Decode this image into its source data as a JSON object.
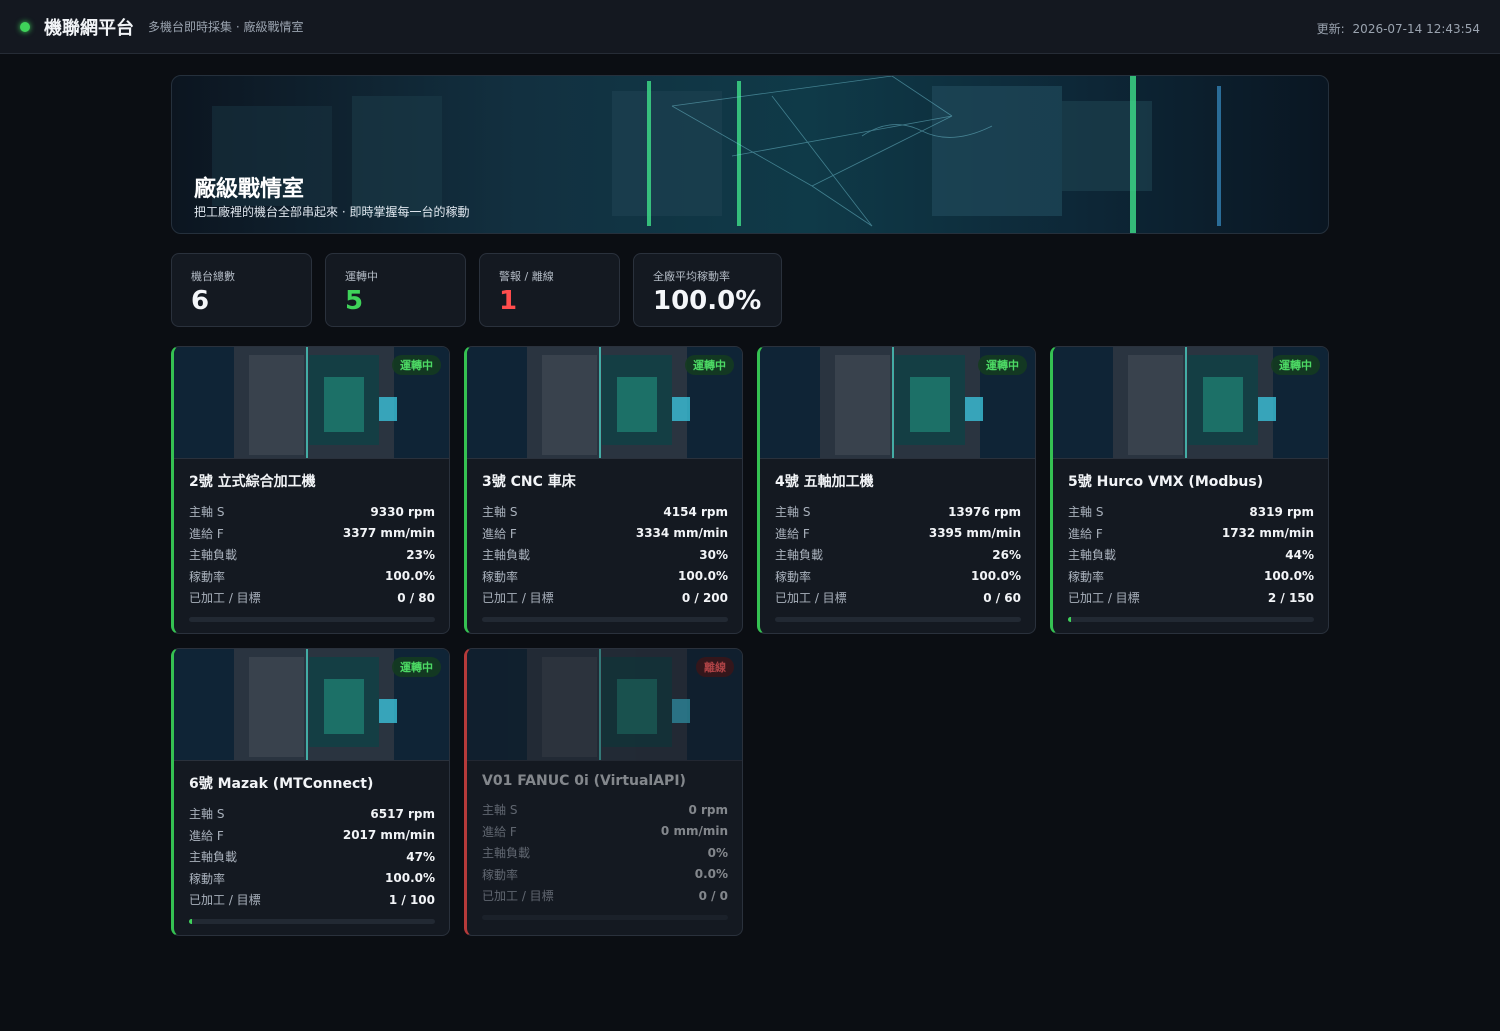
{
  "header": {
    "title": "機聯網平台",
    "subtitle": "多機台即時採集 · 廠級戰情室",
    "updated_label": "更新:",
    "updated_value": "2026-07-14 12:43:54"
  },
  "hero": {
    "title": "廠級戰情室",
    "subtitle": "把工廠裡的機台全部串起來 · 即時掌握每一台的稼動"
  },
  "stats": [
    {
      "label": "機台總數",
      "value": "6",
      "color": "#f4f6f9"
    },
    {
      "label": "運轉中",
      "value": "5",
      "color": "#3fd35a"
    },
    {
      "label": "警報 / 離線",
      "value": "1",
      "color": "#ff4d4d"
    },
    {
      "label": "全廠平均稼動率",
      "value": "100.0%",
      "color": "#f4f6f9"
    }
  ],
  "field_labels": {
    "spindle": "主軸 S",
    "feed": "進給 F",
    "load": "主軸負載",
    "utilization": "稼動率",
    "count": "已加工 / 目標"
  },
  "machines": [
    {
      "name": "2號 立式綜合加工機",
      "status": "運轉中",
      "spindle": "9330 rpm",
      "feed": "3377 mm/min",
      "load": "23%",
      "utilization": "100.0%",
      "count": "0 / 80",
      "progress": 0
    },
    {
      "name": "3號 CNC 車床",
      "status": "運轉中",
      "spindle": "4154 rpm",
      "feed": "3334 mm/min",
      "load": "30%",
      "utilization": "100.0%",
      "count": "0 / 200",
      "progress": 0
    },
    {
      "name": "4號 五軸加工機",
      "status": "運轉中",
      "spindle": "13976 rpm",
      "feed": "3395 mm/min",
      "load": "26%",
      "utilization": "100.0%",
      "count": "0 / 60",
      "progress": 0
    },
    {
      "name": "5號 Hurco VMX (Modbus)",
      "status": "運轉中",
      "spindle": "8319 rpm",
      "feed": "1732 mm/min",
      "load": "44%",
      "utilization": "100.0%",
      "count": "2 / 150",
      "progress": 0.013
    },
    {
      "name": "6號 Mazak (MTConnect)",
      "status": "運轉中",
      "spindle": "6517 rpm",
      "feed": "2017 mm/min",
      "load": "47%",
      "utilization": "100.0%",
      "count": "1 / 100",
      "progress": 0.01
    },
    {
      "name": "V01 FANUC 0i (VirtualAPI)",
      "status": "離線",
      "spindle": "0 rpm",
      "feed": "0 mm/min",
      "load": "0%",
      "utilization": "0.0%",
      "count": "0 / 0",
      "progress": 0
    }
  ]
}
